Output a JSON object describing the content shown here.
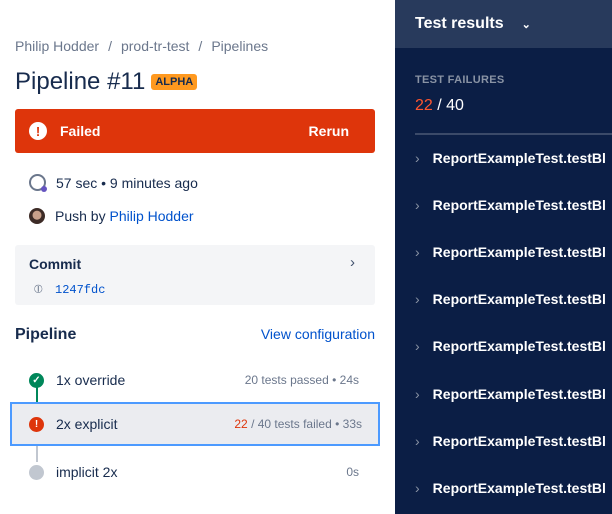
{
  "breadcrumb": [
    "Philip Hodder",
    "prod-tr-test",
    "Pipelines"
  ],
  "title": "Pipeline #11",
  "badge": "ALPHA",
  "status": {
    "label": "Failed",
    "action": "Rerun",
    "color": "#de350b"
  },
  "duration": "57 sec • 9 minutes ago",
  "push": {
    "prefix": "Push by",
    "user": "Philip Hodder"
  },
  "commit": {
    "label": "Commit",
    "hash": "1247fdc"
  },
  "pipeline": {
    "heading": "Pipeline",
    "link": "View configuration",
    "steps": [
      {
        "name": "1x override",
        "info": "20 tests passed • 24s",
        "status": "passed"
      },
      {
        "name": "2x explicit",
        "failed": "22",
        "info": " / 40 tests failed • 33s",
        "status": "failed"
      },
      {
        "name": "implicit 2x",
        "info": "0s",
        "status": "pending"
      }
    ]
  },
  "results": {
    "title": "Test results",
    "section": "TEST FAILURES",
    "failed": "22",
    "total": " / 40",
    "rows": [
      "ReportExampleTest.",
      "ReportExampleTest.",
      "ReportExampleTest.",
      "ReportExampleTest.",
      "ReportExampleTest.",
      "ReportExampleTest.",
      "ReportExampleTest.",
      "ReportExampleTest."
    ],
    "method": "testBl"
  }
}
